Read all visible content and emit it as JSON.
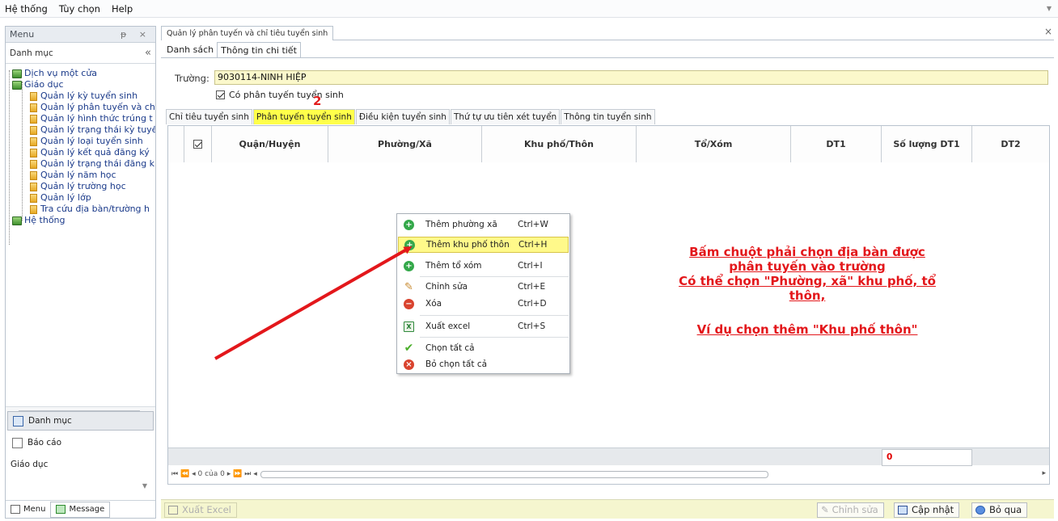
{
  "menubar": {
    "items": [
      "Hệ thống",
      "Tùy chọn",
      "Help"
    ]
  },
  "left_panel": {
    "title": "Menu",
    "header_controls": "ᵽ ×",
    "category_label": "Danh mục",
    "collapse_glyph": "«",
    "tree": {
      "root1": "Dịch vụ một cửa",
      "root2": "Giáo dục",
      "children": [
        "Quản lý kỳ tuyển sinh",
        "Quản lý phân tuyến và ch",
        "Quản lý hình thức trúng t",
        "Quản lý trạng thái kỳ tuyể",
        "Quản lý loại tuyển sinh",
        "Quản lý kết quả đăng ký",
        "Quản lý trạng thái đăng k",
        "Quản lý năm học",
        "Quản lý trường học",
        "Quản lý lớp",
        "Tra cứu địa bàn/trường h"
      ],
      "root3": "Hệ thống"
    },
    "buttons": {
      "danh_muc": "Danh mục",
      "bao_cao": "Báo cáo",
      "giao_duc": "Giáo dục"
    },
    "bottom_tabs": {
      "menu": "Menu",
      "message": "Message"
    }
  },
  "document_tab": {
    "title": "Quản lý phân tuyến và chỉ tiêu tuyển sinh",
    "close": "×"
  },
  "sub_tabs": [
    "Danh sách",
    "Thông tin chi tiết"
  ],
  "form": {
    "truong_label": "Trường:",
    "truong_value": "9030114-NINH HIỆP",
    "co_phan_tuyen_label": "Có phân tuyến tuyển sinh",
    "co_phan_tuyen_checked": true,
    "marker": "2"
  },
  "content_tabs": [
    "Chỉ tiêu tuyển sinh",
    "Phân tuyến tuyển sinh",
    "Điều kiện tuyển sinh",
    "Thứ tự ưu tiên xét tuyển",
    "Thông tin tuyển sinh"
  ],
  "grid": {
    "columns": [
      "Quận/Huyện",
      "Phường/Xã",
      "Khu phố/Thôn",
      "Tổ/Xóm",
      "DT1",
      "Số lượng DT1",
      "DT2"
    ],
    "footer_total": "0",
    "pager": {
      "nav_first": "⏮",
      "nav_prev_page": "⏪",
      "nav_prev": "◂",
      "text": "0 của 0",
      "nav_next": "▸",
      "nav_next_page": "⏩",
      "nav_last": "⏭",
      "scroll_left": "◂",
      "scroll_right": "▸"
    }
  },
  "context_menu": {
    "items": [
      {
        "label": "Thêm phường xã",
        "shortcut": "Ctrl+W",
        "icon": "add-icon"
      },
      {
        "label": "Thêm khu phố thôn",
        "shortcut": "Ctrl+H",
        "icon": "add-icon"
      },
      {
        "label": "Thêm tổ xóm",
        "shortcut": "Ctrl+I",
        "icon": "add-icon"
      },
      {
        "label": "Chỉnh sửa",
        "shortcut": "Ctrl+E",
        "icon": "pencil-icon"
      },
      {
        "label": "Xóa",
        "shortcut": "Ctrl+D",
        "icon": "remove-icon"
      },
      {
        "label": "Xuất excel",
        "shortcut": "Ctrl+S",
        "icon": "excel-icon"
      },
      {
        "label": "Chọn tất cả",
        "shortcut": "",
        "icon": "check-icon"
      },
      {
        "label": "Bỏ chọn tất cả",
        "shortcut": "",
        "icon": "cancel-icon"
      }
    ]
  },
  "annotation": {
    "line1": "Bấm chuột phải chọn địa bàn được",
    "line2": "phân tuyến vào trường",
    "line3": "Có thể chọn \"Phường, xã\" khu phố, tổ",
    "line4": "thôn,",
    "line5": "Ví dụ chọn thêm \"Khu phố thôn\""
  },
  "bottom_bar": {
    "xuat_excel": "Xuất Excel",
    "chinh_sua": "Chỉnh sửa",
    "cap_nhat": "Cập nhật",
    "bo_qua": "Bỏ qua"
  },
  "colors": {
    "highlight_yellow": "#ffff4a",
    "annotation_red": "#e3171b",
    "field_bg": "#fbf8cb"
  }
}
